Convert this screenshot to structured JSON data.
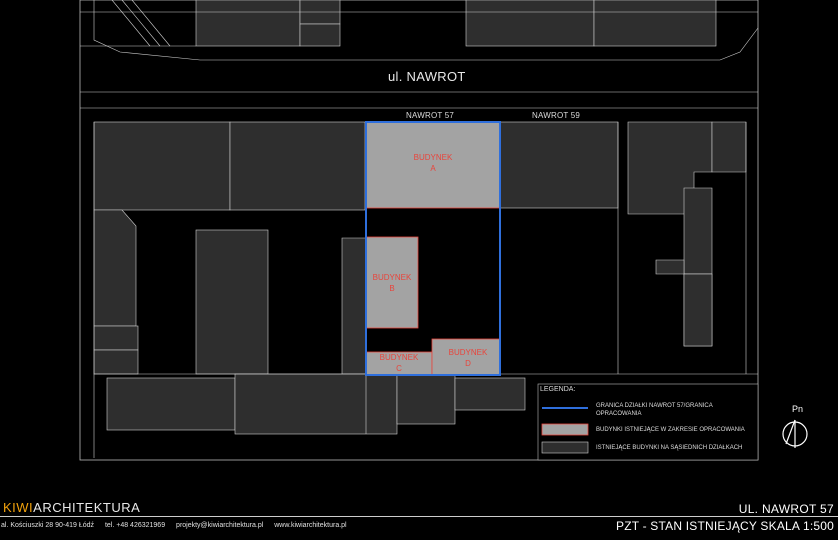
{
  "street": {
    "name": "ul. NAWROT"
  },
  "plots": {
    "nawrot57": "NAWROT 57",
    "nawrot59": "NAWROT 59"
  },
  "buildings": {
    "a": {
      "line1": "BUDYNEK",
      "line2": "A"
    },
    "b": {
      "line1": "BUDYNEK",
      "line2": "B"
    },
    "c": {
      "line1": "BUDYNEK",
      "line2": "C"
    },
    "d": {
      "line1": "BUDYNEK",
      "line2": "D"
    }
  },
  "legend": {
    "title": "LEGENDA:",
    "items": [
      {
        "text": "GRANICA DZIAŁKI NAWROT 57/GRANICA OPRACOWANIA",
        "swatch": "line",
        "color": "#2f6fdc"
      },
      {
        "text": "BUDYNKI ISTNIEJĄCE W ZAKRESIE OPRACOWANIA",
        "swatch": "fill",
        "color": "#a3a3a3"
      },
      {
        "text": "ISTNIEJĄCE BUDYNKI NA SĄSIEDNICH DZIAŁKACH",
        "swatch": "fill",
        "color": "#2e2e2e"
      }
    ]
  },
  "north": {
    "label": "Pn"
  },
  "footer": {
    "brand_kiwi": "KIWI",
    "brand_rest": "ARCHITEKTURA",
    "address": "al. Kościuszki 28 90-419 Łódź",
    "phone": "tel. +48 426321969",
    "email": "projekty@kiwiarchitektura.pl",
    "web": "www.kiwiarchitektura.pl",
    "project": "UL. NAWROT 57",
    "sheet": "PZT - STAN ISTNIEJĄCY SKALA 1:500"
  },
  "colors": {
    "background": "#000000",
    "neighbor_building": "#2e2e2e",
    "project_building": "#a3a3a3",
    "plot_boundary": "#2f6fdc",
    "building_outline": "#e8453c",
    "brand_accent": "#f2a20c"
  }
}
